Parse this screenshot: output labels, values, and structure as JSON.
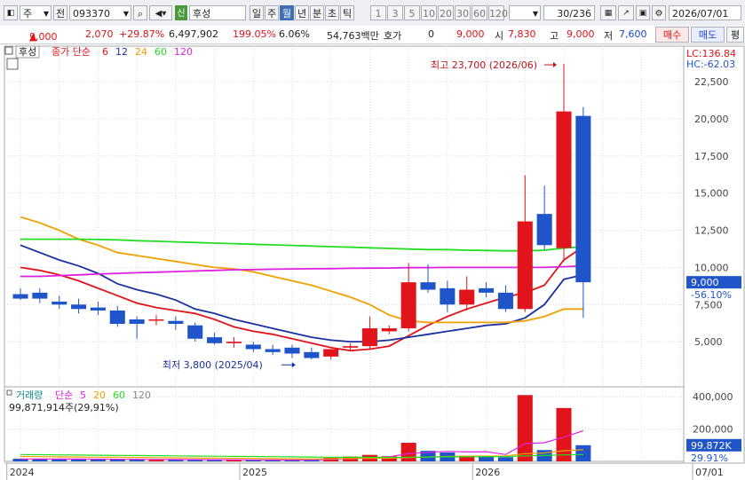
{
  "toolbar": {
    "layout_icon": "layout-icon",
    "market": "주",
    "code_prefix": "전",
    "code": "093370",
    "stock_badge": "신",
    "stock_name": "후성",
    "periods": [
      "일",
      "주",
      "월",
      "년",
      "분",
      "초",
      "틱"
    ],
    "active_period": "월",
    "intervals": [
      "1",
      "3",
      "5",
      "10",
      "20",
      "30",
      "60",
      "120"
    ],
    "count": "30",
    "total": "/236",
    "date": "2026/07/01"
  },
  "quote": {
    "price": "9,000",
    "change": "2,070",
    "change_pct": "+29.87%",
    "volume": "6,497,902",
    "vol_ratio": "199.05%",
    "turnover_pct": "6.06%",
    "trade_value": "54,763백만",
    "bid_label": "호가",
    "bid_value": "0",
    "ask_value": "9,000",
    "open_label": "시",
    "open": "7,830",
    "high_label": "고",
    "high": "9,000",
    "low_label": "저",
    "low": "7,600",
    "buy_button": "매수",
    "sell_button": "매도",
    "eval_button": "평"
  },
  "chart_data": {
    "type": "candlestick",
    "legend": {
      "stock_label": "후성",
      "ma_label": "종가 단순",
      "ma_periods": [
        "6",
        "12",
        "24",
        "60",
        "120"
      ],
      "ma_colors": [
        "#e0141a",
        "#1a2fa0",
        "#f0a000",
        "#22dd22",
        "#e020e0"
      ]
    },
    "lc_label": "LC:136.84",
    "hc_label": "HC:-62.03",
    "max_annotation": "최고 23,700 (2026/06)",
    "min_annotation": "최저 3,800 (2025/04)",
    "current_price_label": "9,000",
    "current_change_label": "-56.10%",
    "y_ticks": [
      5000,
      7500,
      10000,
      12500,
      15000,
      17500,
      20000,
      22500
    ],
    "y_tick_labels": [
      "5,000",
      "7,500",
      "10,000",
      "12,500",
      "15,000",
      "17,500",
      "20,000",
      "22,500"
    ],
    "ylim": [
      2200,
      24300
    ],
    "x_labels": [
      {
        "label": "2024",
        "index": 0
      },
      {
        "label": "2025",
        "index": 12
      },
      {
        "label": "2026",
        "index": 24
      },
      {
        "label": "07/01",
        "index": 30
      }
    ],
    "candles": [
      {
        "o": 8200,
        "h": 8600,
        "l": 7800,
        "c": 7900
      },
      {
        "o": 8300,
        "h": 8600,
        "l": 7600,
        "c": 7900
      },
      {
        "o": 7700,
        "h": 8100,
        "l": 7200,
        "c": 7500
      },
      {
        "o": 7500,
        "h": 7900,
        "l": 6900,
        "c": 7200
      },
      {
        "o": 7300,
        "h": 7700,
        "l": 6800,
        "c": 7100
      },
      {
        "o": 7100,
        "h": 7400,
        "l": 6000,
        "c": 6200
      },
      {
        "o": 6500,
        "h": 6700,
        "l": 5200,
        "c": 6200
      },
      {
        "o": 6500,
        "h": 6800,
        "l": 6100,
        "c": 6500
      },
      {
        "o": 6400,
        "h": 6700,
        "l": 5800,
        "c": 6200
      },
      {
        "o": 6100,
        "h": 6300,
        "l": 5000,
        "c": 5200
      },
      {
        "o": 5300,
        "h": 5600,
        "l": 4800,
        "c": 4900
      },
      {
        "o": 4900,
        "h": 5300,
        "l": 4600,
        "c": 5000
      },
      {
        "o": 4800,
        "h": 5000,
        "l": 4300,
        "c": 4500
      },
      {
        "o": 4500,
        "h": 4800,
        "l": 4100,
        "c": 4300
      },
      {
        "o": 4600,
        "h": 4800,
        "l": 3900,
        "c": 4200
      },
      {
        "o": 4300,
        "h": 4600,
        "l": 3800,
        "c": 3900
      },
      {
        "o": 4000,
        "h": 4500,
        "l": 3800,
        "c": 4500
      },
      {
        "o": 4600,
        "h": 4900,
        "l": 4400,
        "c": 4700
      },
      {
        "o": 4700,
        "h": 6700,
        "l": 4500,
        "c": 5900
      },
      {
        "o": 5700,
        "h": 6100,
        "l": 5500,
        "c": 5900
      },
      {
        "o": 5900,
        "h": 10300,
        "l": 5700,
        "c": 9000
      },
      {
        "o": 9000,
        "h": 10200,
        "l": 8300,
        "c": 8500
      },
      {
        "o": 8600,
        "h": 9100,
        "l": 7000,
        "c": 7500
      },
      {
        "o": 7500,
        "h": 9400,
        "l": 7100,
        "c": 8500
      },
      {
        "o": 8600,
        "h": 9000,
        "l": 8000,
        "c": 8300
      },
      {
        "o": 8300,
        "h": 8800,
        "l": 7000,
        "c": 7200
      },
      {
        "o": 7200,
        "h": 16200,
        "l": 7000,
        "c": 13100
      },
      {
        "o": 13600,
        "h": 15500,
        "l": 11200,
        "c": 11500
      },
      {
        "o": 11300,
        "h": 23700,
        "l": 10400,
        "c": 20500
      },
      {
        "o": 20200,
        "h": 20800,
        "l": 6600,
        "c": 9000
      }
    ],
    "ma": [
      {
        "period": "6",
        "color": "#e0141a",
        "values": [
          10000,
          9800,
          9500,
          9100,
          8600,
          8100,
          7600,
          7300,
          7100,
          6900,
          6500,
          6000,
          5700,
          5500,
          5200,
          4900,
          4600,
          4400,
          4500,
          4700,
          5400,
          6100,
          6700,
          7200,
          7600,
          8000,
          8300,
          8800,
          10500,
          11400
        ]
      },
      {
        "period": "12",
        "color": "#1a2fa0",
        "values": [
          11500,
          11000,
          10500,
          10100,
          9600,
          8900,
          8500,
          8200,
          7800,
          7200,
          6900,
          6500,
          6200,
          5900,
          5600,
          5300,
          5100,
          5000,
          5000,
          5100,
          5300,
          5500,
          5700,
          5900,
          6100,
          6200,
          6600,
          7500,
          9200,
          9500
        ]
      },
      {
        "period": "24",
        "color": "#f0a000",
        "values": [
          13400,
          13000,
          12500,
          11900,
          11500,
          11000,
          10800,
          10600,
          10400,
          10200,
          10000,
          9900,
          9700,
          9400,
          9100,
          8800,
          8400,
          8000,
          7500,
          6800,
          6400,
          6300,
          6300,
          6300,
          6300,
          6300,
          6400,
          6700,
          7200,
          7200
        ]
      },
      {
        "period": "60",
        "color": "#22dd22",
        "values": [
          11900,
          11900,
          11900,
          11900,
          11880,
          11850,
          11800,
          11760,
          11720,
          11680,
          11640,
          11600,
          11560,
          11520,
          11480,
          11440,
          11400,
          11360,
          11320,
          11280,
          11240,
          11200,
          11200,
          11160,
          11140,
          11120,
          11120,
          11160,
          11300,
          11400
        ]
      },
      {
        "period": "120",
        "color": "#e020e0",
        "values": [
          9400,
          9400,
          9450,
          9500,
          9550,
          9600,
          9640,
          9680,
          9720,
          9760,
          9800,
          9840,
          9860,
          9880,
          9900,
          9910,
          9920,
          9940,
          9950,
          9960,
          9980,
          9990,
          10000,
          10000,
          10000,
          10000,
          10000,
          10000,
          10050,
          10100
        ]
      }
    ],
    "volume": {
      "legend_label": "거래량",
      "ma_label": "단순",
      "ma_periods": [
        "5",
        "20",
        "60",
        "120"
      ],
      "ma_colors": [
        "#e020e0",
        "#f0a000",
        "#22dd22",
        "#888888"
      ],
      "summary": "99,871,914주(29,91%)",
      "y_ticks": [
        200000,
        400000
      ],
      "y_tick_labels": [
        "200,000",
        "400,000"
      ],
      "ylim": [
        0,
        450000
      ],
      "current_label": "99.872K",
      "current_pct_label": "29.91%",
      "unit": "K",
      "values": [
        16000,
        15000,
        13000,
        11000,
        12000,
        14000,
        12000,
        10000,
        11000,
        12000,
        10000,
        9000,
        8000,
        8000,
        9000,
        10000,
        22000,
        30000,
        40000,
        32000,
        115000,
        65000,
        55000,
        35000,
        28000,
        26000,
        410000,
        70000,
        330000,
        99872
      ],
      "ma5": [
        15000,
        15000,
        14500,
        14000,
        13500,
        13000,
        12500,
        12000,
        11500,
        11000,
        10500,
        10000,
        9500,
        9000,
        9000,
        9000,
        12000,
        16000,
        22000,
        28000,
        48000,
        56000,
        62000,
        58000,
        60000,
        42000,
        110000,
        115000,
        150000,
        190000
      ],
      "ma20": [
        30000,
        29000,
        28000,
        27000,
        26000,
        25000,
        24000,
        23000,
        22000,
        21000,
        20000,
        19000,
        18000,
        17000,
        16000,
        15000,
        16000,
        17000,
        18000,
        19000,
        24000,
        27000,
        30000,
        32000,
        33000,
        34000,
        48000,
        52000,
        66000,
        72000
      ],
      "ma60": [
        42000,
        41000,
        40000,
        39000,
        38000,
        37000,
        36000,
        35000,
        34000,
        33000,
        32000,
        31000,
        30000,
        29000,
        28000,
        27000,
        26000,
        25500,
        25000,
        24500,
        26000,
        27000,
        28000,
        28500,
        29000,
        29500,
        34000,
        36000,
        40000,
        42000
      ]
    }
  }
}
